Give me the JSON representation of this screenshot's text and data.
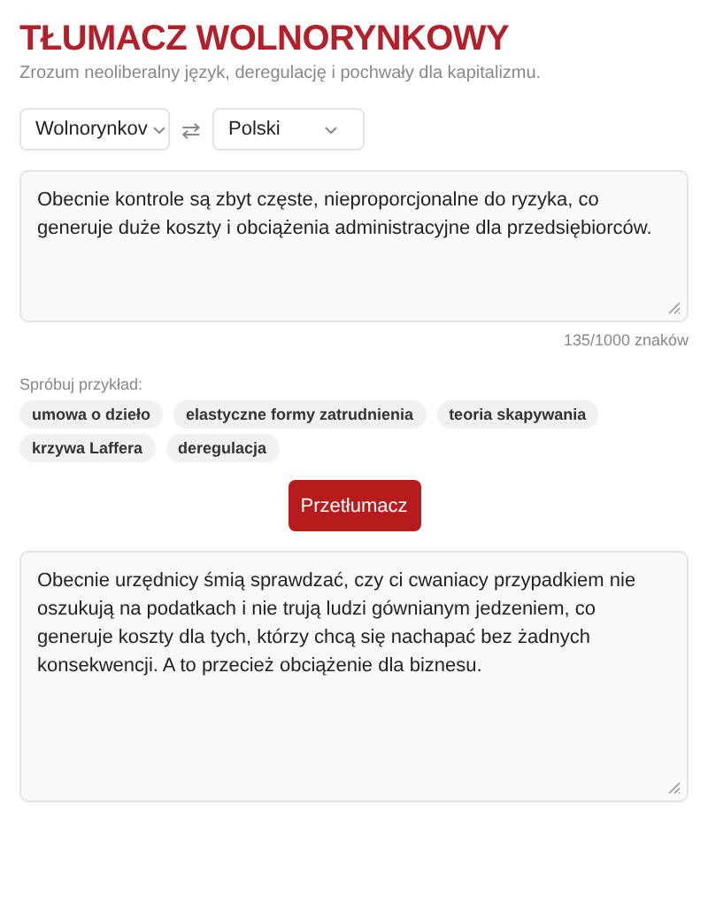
{
  "header": {
    "title": "TŁUMACZ WOLNORYNKOWY",
    "subtitle": "Zrozum neoliberalny język, deregulację i pochwały dla kapitalizmu."
  },
  "languages": {
    "source": "Wolnorynkov",
    "swap": "⇄",
    "target": "Polski"
  },
  "input": {
    "value": "Obecnie kontrole są zbyt częste, nieproporcjonalne do ryzyka, co generuje duże koszty i obciążenia administracyjne dla przedsiębiorców.",
    "counter": "135/1000 znaków"
  },
  "examples": {
    "label": "Spróbuj przykład:",
    "items": [
      "umowa o dzieło",
      "elastyczne formy zatrudnienia",
      "teoria skapywania",
      "krzywa Laffera",
      "deregulacja"
    ]
  },
  "translate_button": "Przetłumacz",
  "output": {
    "value": "Obecnie urzędnicy śmią sprawdzać, czy ci cwaniacy przypadkiem nie oszukują na podatkach i nie trują ludzi gównianym jedzeniem, co generuje koszty dla tych, którzy chcą się nachapać bez żadnych konsekwencji. A to przecież obciążenie dla biznesu."
  }
}
